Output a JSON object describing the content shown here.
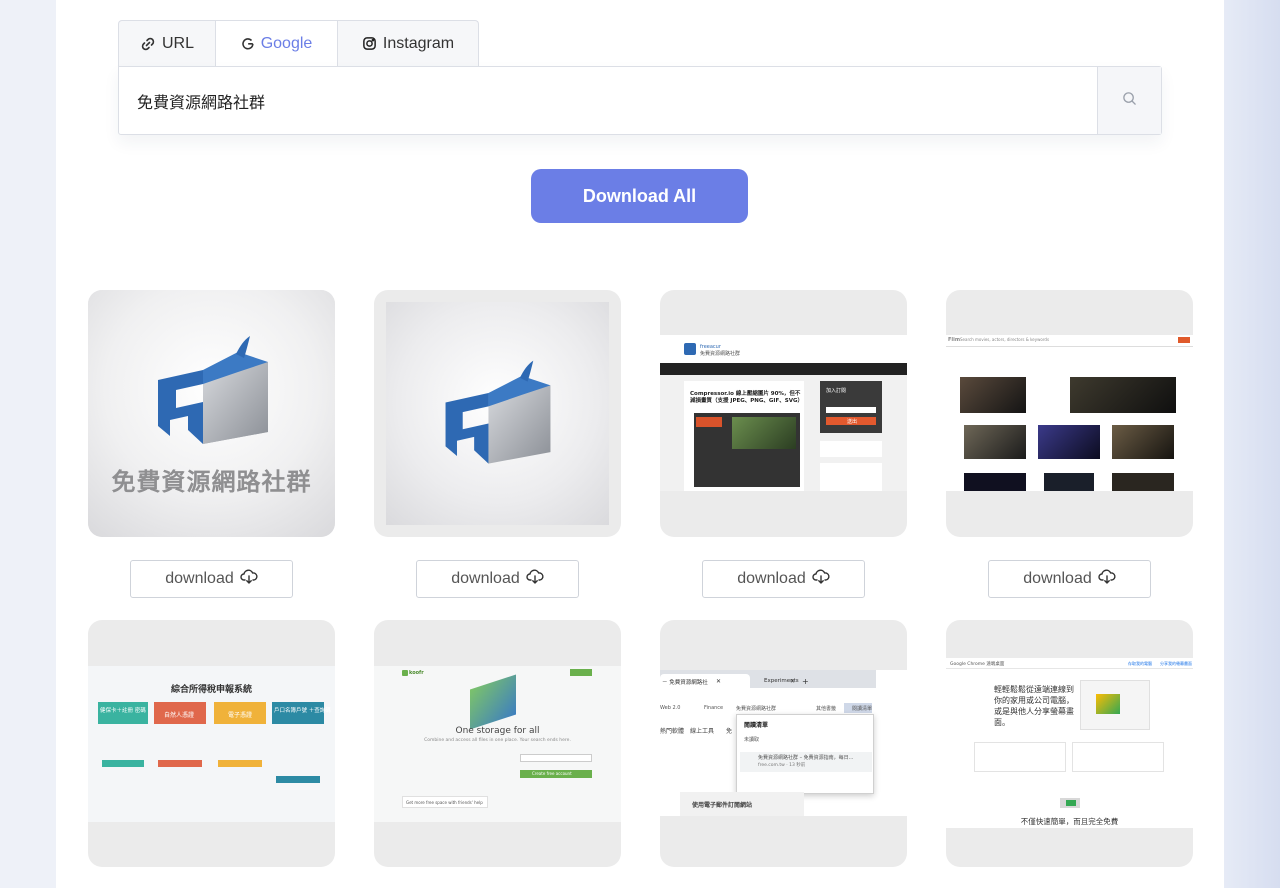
{
  "tabs": [
    {
      "label": "URL",
      "icon": "link-icon"
    },
    {
      "label": "Google",
      "icon": "google-icon"
    },
    {
      "label": "Instagram",
      "icon": "instagram-icon"
    }
  ],
  "active_tab": "Google",
  "search": {
    "value": "免費資源網路社群",
    "icon": "search-icon"
  },
  "download_all_label": "Download All",
  "colors": {
    "accent": "#6b7ee6",
    "card_bg": "#ebebeb",
    "border": "#dcdfe6"
  },
  "download_label": "download",
  "results": {
    "r1": {
      "logo_text": "免費資源網路社群"
    },
    "r3": {
      "brand": "freeacur",
      "site": "免費資源網路社群",
      "headline": "Compressor.io 線上壓縮圖片 90%，但不",
      "headline2": "減損畫質（支援 JPEG、PNG、GIF、SVG）",
      "side_title": "加入訂閱",
      "side_btn": "送出"
    },
    "r4": {
      "brand": "Flim",
      "search_ph": "Search movies, actors, directors & keywords",
      "login": "Login"
    },
    "r5": {
      "title": "綜合所得稅申報系統",
      "cards": [
        "健保卡＋註冊\n密碼",
        "自然人憑證",
        "電子憑證",
        "戶口名簿戶號\n＋查詢碼"
      ]
    },
    "r6": {
      "brand": "koofr",
      "headline": "One storage for all",
      "sub": "Combine and access all files in one place. Your search ends here.",
      "cta": "Create free account",
      "footer": "Get more free space with friends' help"
    },
    "r7": {
      "tab1": "－ 免費資源網路社",
      "tab2": "Experiments",
      "bm1": "Web 2.0",
      "bm2": "Finance",
      "bm3": "免費資源網路社群",
      "bm4": "其他書籤",
      "bm5": "閱讀清單",
      "nav1": "熱門軟體",
      "nav2": "線上工具",
      "nav3": "免",
      "pop_title": "閱讀清單",
      "pop_sub": "未讀取",
      "pop_item": "免費資源網路社群 – 免費資源指南，每日...",
      "pop_meta": "free.com.tw · 13 秒前",
      "footer": "使用電子郵件訂閱網站"
    },
    "r8": {
      "header": "Google Chrome 遠端桌面",
      "link1": "存取我的電腦",
      "link2": "分享我的螢幕畫面",
      "headline": "輕輕鬆鬆從遠端連線到\n你的家用或公司電腦，\n或是與他人分享螢幕畫\n面。",
      "bottom": "不僅快速簡單，而且完全免費"
    }
  }
}
